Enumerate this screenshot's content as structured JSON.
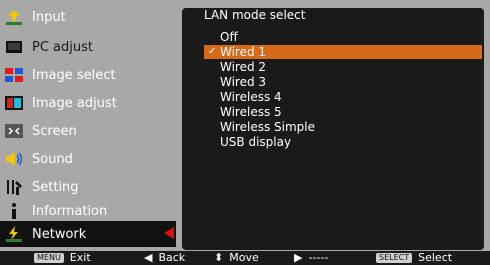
{
  "menu": {
    "items": [
      {
        "label": "Input",
        "icon": "input-icon"
      },
      {
        "label": "PC adjust",
        "icon": "pc-adjust-icon"
      },
      {
        "label": "Image select",
        "icon": "image-select-icon"
      },
      {
        "label": "Image adjust",
        "icon": "image-adjust-icon"
      },
      {
        "label": "Screen",
        "icon": "screen-icon"
      },
      {
        "label": "Sound",
        "icon": "sound-icon"
      },
      {
        "label": "Setting",
        "icon": "setting-icon"
      },
      {
        "label": "Information",
        "icon": "information-icon"
      },
      {
        "label": "Network",
        "icon": "network-icon"
      }
    ],
    "selected_index": 8
  },
  "panel": {
    "title": "LAN mode select",
    "options": [
      "Off",
      "Wired 1",
      "Wired 2",
      "Wired 3",
      "Wireless 4",
      "Wireless 5",
      "Wireless Simple",
      "USB display"
    ],
    "active_index": 1,
    "checked_index": 1
  },
  "bottom": {
    "menu_key": "MENU",
    "exit": "Exit",
    "back": "Back",
    "move": "Move",
    "next": "-----",
    "select_key": "SELECT",
    "select": "Select"
  },
  "colors": {
    "background": "#a8a8a8",
    "panel": "#1a1a1a",
    "highlight": "#d46a1a",
    "selected_marker": "#e01010"
  }
}
